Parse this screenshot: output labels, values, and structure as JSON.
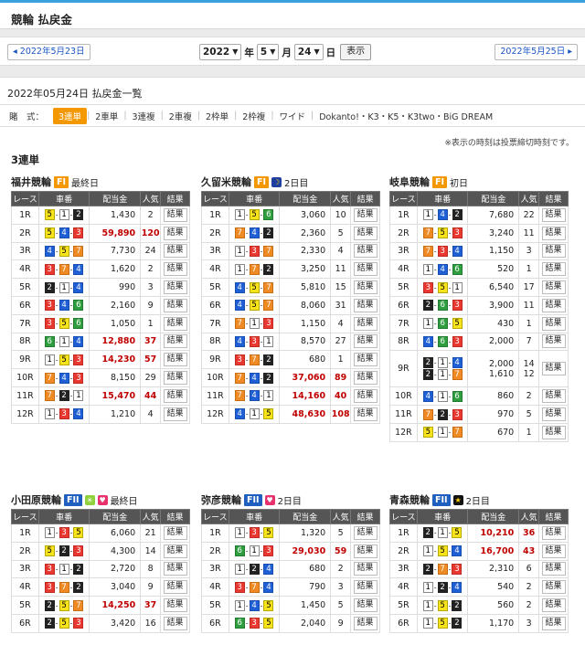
{
  "header": {
    "title": "競輪 払戻金"
  },
  "nav": {
    "prev": "◂ 2022年5月23日",
    "next": "2022年5月25日 ▸",
    "year": "2022",
    "year_unit": "年",
    "month": "5",
    "month_unit": "月",
    "day": "24",
    "day_unit": "日",
    "show_button": "表示"
  },
  "panel": {
    "heading": "2022年05月24日 払戻金一覧",
    "bet_label": "賭　式：",
    "tabs": [
      "3連単",
      "2車単",
      "3連複",
      "2車複",
      "2枠単",
      "2枠複",
      "ワイド",
      "Dokanto!・K3・K5・K3two・BiG DREAM"
    ],
    "active_tab": 0,
    "note": "※表示の時刻は投票締切時刻です。",
    "section_title": "3連単"
  },
  "table_headers": {
    "race": "レース",
    "combo": "車番",
    "pay": "配当金",
    "pop": "人気",
    "result": "結果"
  },
  "result_label": "結果",
  "tracks": [
    {
      "name": "福井競輪",
      "grade": "FI",
      "grade_class": "f1",
      "icons": [],
      "day": "最終日",
      "rows": [
        {
          "r": "1R",
          "c": [
            5,
            1,
            2
          ],
          "p": "1,430",
          "n": "2"
        },
        {
          "r": "2R",
          "c": [
            5,
            4,
            3
          ],
          "p": "59,890",
          "n": "120",
          "hi": true
        },
        {
          "r": "3R",
          "c": [
            4,
            5,
            7
          ],
          "p": "7,730",
          "n": "24"
        },
        {
          "r": "4R",
          "c": [
            3,
            7,
            4
          ],
          "p": "1,620",
          "n": "2"
        },
        {
          "r": "5R",
          "c": [
            2,
            1,
            4
          ],
          "p": "990",
          "n": "3"
        },
        {
          "r": "6R",
          "c": [
            3,
            4,
            6
          ],
          "p": "2,160",
          "n": "9"
        },
        {
          "r": "7R",
          "c": [
            3,
            5,
            6
          ],
          "p": "1,050",
          "n": "1"
        },
        {
          "r": "8R",
          "c": [
            6,
            1,
            4
          ],
          "p": "12,880",
          "n": "37",
          "hi": true
        },
        {
          "r": "9R",
          "c": [
            1,
            5,
            3
          ],
          "p": "14,230",
          "n": "57",
          "hi": true
        },
        {
          "r": "10R",
          "c": [
            7,
            4,
            3
          ],
          "p": "8,150",
          "n": "29"
        },
        {
          "r": "11R",
          "c": [
            7,
            2,
            1
          ],
          "p": "15,470",
          "n": "44",
          "hi": true
        },
        {
          "r": "12R",
          "c": [
            1,
            3,
            4
          ],
          "p": "1,210",
          "n": "4"
        }
      ]
    },
    {
      "name": "久留米競輪",
      "grade": "FI",
      "grade_class": "f1",
      "icons": [
        "night"
      ],
      "day": "2日目",
      "rows": [
        {
          "r": "1R",
          "c": [
            1,
            5,
            6
          ],
          "p": "3,060",
          "n": "10"
        },
        {
          "r": "2R",
          "c": [
            7,
            4,
            2
          ],
          "p": "2,360",
          "n": "5"
        },
        {
          "r": "3R",
          "c": [
            1,
            3,
            7
          ],
          "p": "2,330",
          "n": "4"
        },
        {
          "r": "4R",
          "c": [
            1,
            7,
            2
          ],
          "p": "3,250",
          "n": "11"
        },
        {
          "r": "5R",
          "c": [
            4,
            5,
            7
          ],
          "p": "5,810",
          "n": "15"
        },
        {
          "r": "6R",
          "c": [
            4,
            5,
            7
          ],
          "p": "8,060",
          "n": "31"
        },
        {
          "r": "7R",
          "c": [
            7,
            1,
            3
          ],
          "p": "1,150",
          "n": "4"
        },
        {
          "r": "8R",
          "c": [
            4,
            3,
            1
          ],
          "p": "8,570",
          "n": "27"
        },
        {
          "r": "9R",
          "c": [
            3,
            7,
            2
          ],
          "p": "680",
          "n": "1"
        },
        {
          "r": "10R",
          "c": [
            7,
            4,
            2
          ],
          "p": "37,060",
          "n": "89",
          "hi": true
        },
        {
          "r": "11R",
          "c": [
            7,
            4,
            1
          ],
          "p": "14,160",
          "n": "40",
          "hi": true
        },
        {
          "r": "12R",
          "c": [
            4,
            1,
            5
          ],
          "p": "48,630",
          "n": "108",
          "hi": true
        }
      ]
    },
    {
      "name": "岐阜競輪",
      "grade": "FI",
      "grade_class": "f1",
      "icons": [],
      "day": "初日",
      "rows": [
        {
          "r": "1R",
          "c": [
            1,
            4,
            2
          ],
          "p": "7,680",
          "n": "22"
        },
        {
          "r": "2R",
          "c": [
            7,
            5,
            3
          ],
          "p": "3,240",
          "n": "11"
        },
        {
          "r": "3R",
          "c": [
            7,
            3,
            4
          ],
          "p": "1,150",
          "n": "3"
        },
        {
          "r": "4R",
          "c": [
            1,
            4,
            6
          ],
          "p": "520",
          "n": "1"
        },
        {
          "r": "5R",
          "c": [
            3,
            5,
            1
          ],
          "p": "6,540",
          "n": "17"
        },
        {
          "r": "6R",
          "c": [
            2,
            6,
            3
          ],
          "p": "3,900",
          "n": "11"
        },
        {
          "r": "7R",
          "c": [
            1,
            6,
            5
          ],
          "p": "430",
          "n": "1"
        },
        {
          "r": "8R",
          "c": [
            4,
            6,
            3
          ],
          "p": "2,000",
          "n": "7"
        },
        {
          "r": "9R",
          "c": [
            2,
            1,
            4
          ],
          "c2": [
            2,
            1,
            7
          ],
          "p": "2,000",
          "p2": "1,610",
          "n": "14",
          "n2": "12"
        },
        {
          "r": "10R",
          "c": [
            4,
            1,
            6
          ],
          "p": "860",
          "n": "2"
        },
        {
          "r": "11R",
          "c": [
            7,
            2,
            3
          ],
          "p": "970",
          "n": "5"
        },
        {
          "r": "12R",
          "c": [
            5,
            1,
            7
          ],
          "p": "670",
          "n": "1"
        }
      ]
    },
    {
      "name": "小田原競輪",
      "grade": "FII",
      "grade_class": "f2",
      "icons": [
        "morning",
        "girls"
      ],
      "day": "最終日",
      "rows": [
        {
          "r": "1R",
          "c": [
            1,
            3,
            5
          ],
          "p": "6,060",
          "n": "21"
        },
        {
          "r": "2R",
          "c": [
            5,
            2,
            3
          ],
          "p": "4,300",
          "n": "14"
        },
        {
          "r": "3R",
          "c": [
            3,
            1,
            2
          ],
          "p": "2,720",
          "n": "8"
        },
        {
          "r": "4R",
          "c": [
            3,
            7,
            2
          ],
          "p": "3,040",
          "n": "9"
        },
        {
          "r": "5R",
          "c": [
            2,
            5,
            7
          ],
          "p": "14,250",
          "n": "37",
          "hi": true
        },
        {
          "r": "6R",
          "c": [
            2,
            5,
            3
          ],
          "p": "3,420",
          "n": "16"
        }
      ]
    },
    {
      "name": "弥彦競輪",
      "grade": "FII",
      "grade_class": "f2",
      "icons": [
        "girls"
      ],
      "day": "2日目",
      "rows": [
        {
          "r": "1R",
          "c": [
            1,
            3,
            5
          ],
          "p": "1,320",
          "n": "5"
        },
        {
          "r": "2R",
          "c": [
            6,
            1,
            3
          ],
          "p": "29,030",
          "n": "59",
          "hi": true
        },
        {
          "r": "3R",
          "c": [
            1,
            2,
            4
          ],
          "p": "680",
          "n": "2"
        },
        {
          "r": "4R",
          "c": [
            3,
            7,
            4
          ],
          "p": "790",
          "n": "3"
        },
        {
          "r": "5R",
          "c": [
            1,
            4,
            5
          ],
          "p": "1,450",
          "n": "5"
        },
        {
          "r": "6R",
          "c": [
            6,
            3,
            5
          ],
          "p": "2,040",
          "n": "9"
        }
      ]
    },
    {
      "name": "青森競輪",
      "grade": "FII",
      "grade_class": "f2",
      "icons": [
        "midnight"
      ],
      "day": "2日目",
      "rows": [
        {
          "r": "1R",
          "c": [
            2,
            1,
            5
          ],
          "p": "10,210",
          "n": "36",
          "hi": true
        },
        {
          "r": "2R",
          "c": [
            1,
            5,
            4
          ],
          "p": "16,700",
          "n": "43",
          "hi": true
        },
        {
          "r": "3R",
          "c": [
            2,
            7,
            3
          ],
          "p": "2,310",
          "n": "6"
        },
        {
          "r": "4R",
          "c": [
            1,
            2,
            4
          ],
          "p": "540",
          "n": "2"
        },
        {
          "r": "5R",
          "c": [
            1,
            5,
            2
          ],
          "p": "560",
          "n": "2"
        },
        {
          "r": "6R",
          "c": [
            1,
            5,
            2
          ],
          "p": "1,170",
          "n": "3"
        }
      ]
    }
  ]
}
